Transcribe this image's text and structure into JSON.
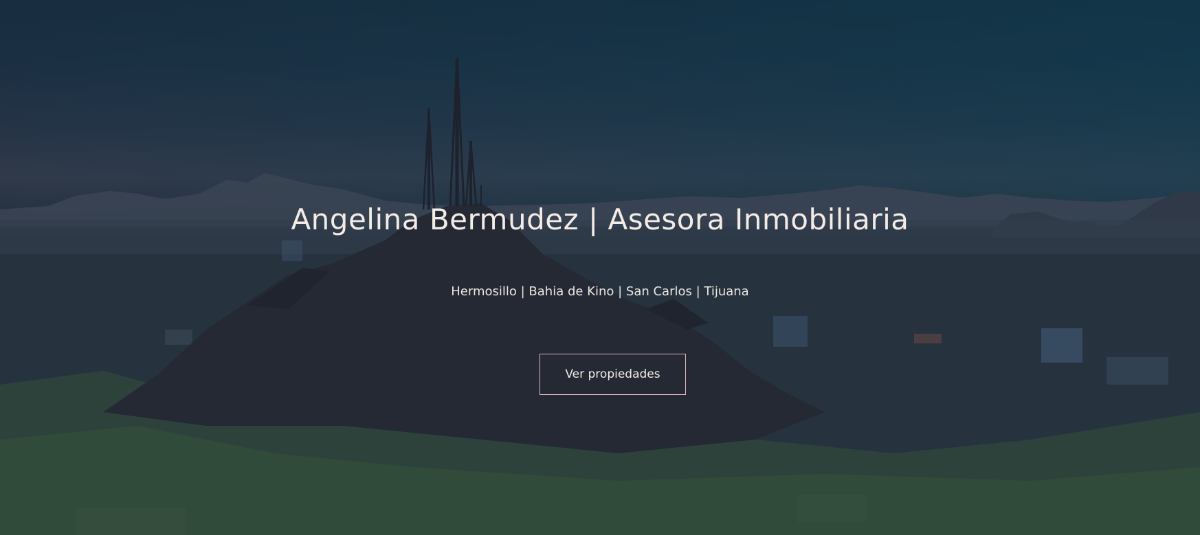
{
  "hero": {
    "title": "Angelina Bermudez | Asesora Inmobiliaria",
    "subtitle": "Hermosillo | Bahia de Kino | San Carlos | Tijuana",
    "cta_label": "Ver propiedades",
    "background_image": "city-hill-antennas-panorama"
  },
  "colors": {
    "text": "#f3ece6",
    "button_border": "#e6b8bf",
    "overlay": "#141c30"
  }
}
